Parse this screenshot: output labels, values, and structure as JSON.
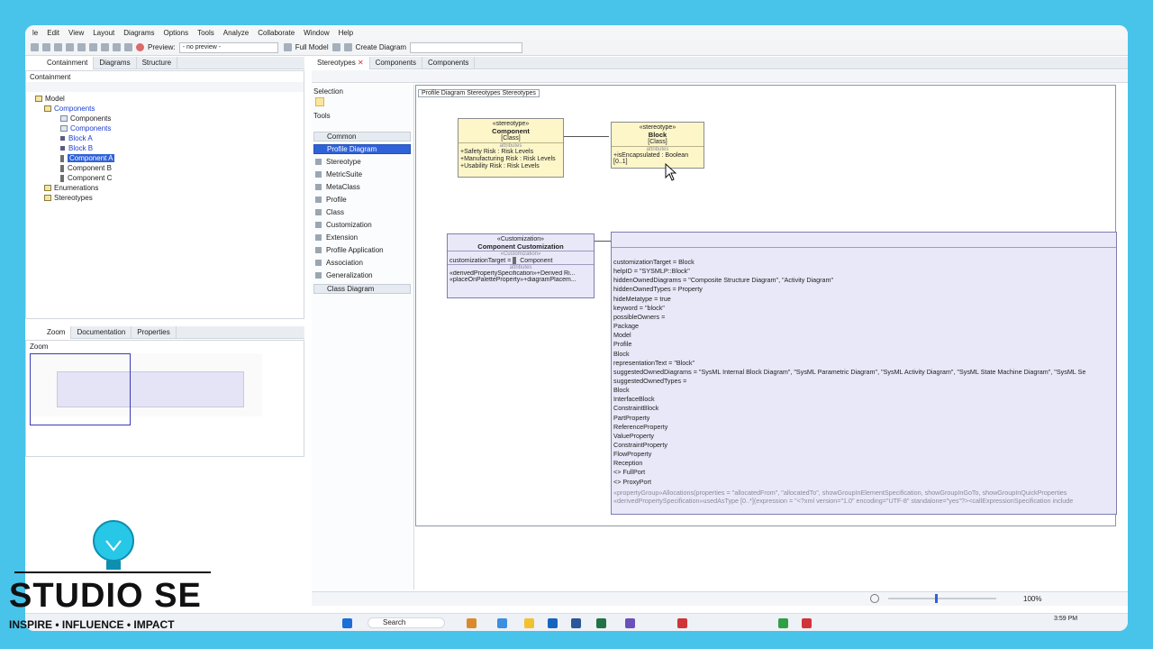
{
  "menu": [
    "le",
    "Edit",
    "View",
    "Layout",
    "Diagrams",
    "Options",
    "Tools",
    "Analyze",
    "Collaborate",
    "Window",
    "Help"
  ],
  "toolbar": {
    "preview_label": "Preview:",
    "preview_value": "- no preview -",
    "full_model_label": "Full Model",
    "create_diagram_label": "Create Diagram"
  },
  "left_tabs": [
    "Containment",
    "Diagrams",
    "Structure"
  ],
  "containment_title": "Containment",
  "tree": {
    "model": "Model",
    "components_pkg": "Components",
    "components_diag": "Components",
    "components_diag2": "Components",
    "block_a": "Block A",
    "block_b": "Block B",
    "component_a": "Component A",
    "component_b": "Component B",
    "component_c": "Component C",
    "enumerations": "Enumerations",
    "stereotypes": "Stereotypes"
  },
  "bottom_tabs": [
    "Zoom",
    "Documentation",
    "Properties"
  ],
  "zoom_title": "Zoom",
  "diagram_tabs": [
    "Stereotypes",
    "Components",
    "Components"
  ],
  "palette": {
    "selection": "Selection",
    "tools": "Tools",
    "common": "Common",
    "profile_diagram": "Profile Diagram",
    "items": [
      "Stereotype",
      "MetricSuite",
      "MetaClass",
      "Profile",
      "Class",
      "Customization",
      "Extension",
      "Profile Application",
      "Association",
      "Generalization"
    ],
    "class_diagram": "Class Diagram"
  },
  "breadcrumb": {
    "kind": "Profile Diagram",
    "name": "Stereotypes",
    "tag": "Stereotypes"
  },
  "component_box": {
    "stereotype": "«stereotype»",
    "name": "Component",
    "metaclass": "[Class]",
    "section": "attributes",
    "attrs": [
      "+Safety Risk : Risk Levels",
      "+Manufacturing Risk : Risk Levels",
      "+Usability Risk : Risk Levels"
    ]
  },
  "block_box": {
    "stereotype": "«stereotype»",
    "name": "Block",
    "metaclass": "[Class]",
    "section": "attributes",
    "attr": "+isEncapsulated : Boolean [0..1]"
  },
  "customization_box": {
    "stereotype": "«Customization»",
    "name": "Component Customization",
    "section1": "«Customization»",
    "target": "customizationTarget = ",
    "target_value": "Component",
    "section2": "attributes",
    "attr1": "«derivedPropertySpecification»+Derived Ri...",
    "attr2": "«placeOnPaletteProperty»+diagramPlacem..."
  },
  "block_custom_lines": [
    "customizationTarget = Block",
    "helpID = \"SYSMLP::Block\"",
    "hiddenOwnedDiagrams = \"Composite Structure Diagram\", \"Activity Diagram\"",
    "hiddenOwnedTypes = Property",
    "hideMetatype = true",
    "keyword = \"block\"",
    "possibleOwners =",
    "Package",
    "Model",
    "Profile",
    "Block",
    "representationText = \"Block\"",
    "suggestedOwnedDiagrams = \"SysML Internal Block Diagram\", \"SysML Parametric Diagram\", \"SysML Activity Diagram\", \"SysML State Machine Diagram\", \"SysML Se",
    "suggestedOwnedTypes =",
    "Block",
    "InterfaceBlock",
    "ConstraintBlock",
    "PartProperty",
    "ReferenceProperty",
    "ValueProperty",
    "ConstraintProperty",
    "FlowProperty",
    "Reception",
    "<> FullPort",
    "<> ProxyPort"
  ],
  "block_custom_footer1": "«propertyGroup»Allocations(properties = \"allocatedFrom\", \"allocatedTo\", showGroupInElementSpecification, showGroupInGoTo, showGroupInQuickProperties",
  "block_custom_footer2": "«derivedPropertySpecification»usedAsType [0..*](expression = \"<?xml version=\"1.0\" encoding=\"UTF-8\" standalone=\"yes\"?><callExpressionSpecification include",
  "status": {
    "zoom_value": "100%",
    "time": "3:59 PM"
  },
  "taskbar": {
    "search_label": "Search"
  },
  "logo": {
    "name": "STUDIO SE",
    "tagline": "INSPIRE  •  INFLUENCE  •  IMPACT"
  },
  "colors": {
    "frame_bg": "#48c3ea",
    "selection_blue": "#2f62d9",
    "stereotype_fill": "#fdf6c9",
    "customization_fill": "#e8e8f8"
  }
}
